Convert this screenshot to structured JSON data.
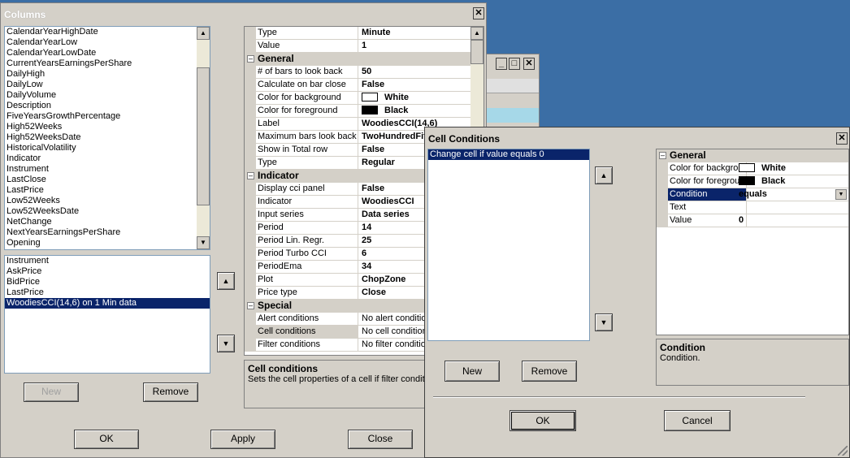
{
  "bg_window": {
    "col1": "",
    "col2": ""
  },
  "columns": {
    "title": "Columns",
    "available": [
      "CalendarYearHighDate",
      "CalendarYearLow",
      "CalendarYearLowDate",
      "CurrentYearsEarningsPerShare",
      "DailyHigh",
      "DailyLow",
      "DailyVolume",
      "Description",
      "FiveYearsGrowthPercentage",
      "High52Weeks",
      "High52WeeksDate",
      "HistoricalVolatility",
      "Indicator",
      "Instrument",
      "LastClose",
      "LastPrice",
      "Low52Weeks",
      "Low52WeeksDate",
      "NetChange",
      "NextYearsEarningsPerShare",
      "Opening"
    ],
    "selected": [
      "Instrument",
      "AskPrice",
      "BidPrice",
      "LastPrice",
      "WoodiesCCI(14,6) on 1 Min data"
    ],
    "new_label": "New",
    "remove_label": "Remove",
    "ok_label": "OK",
    "apply_label": "Apply",
    "close_label": "Close",
    "props": {
      "top": [
        [
          "Type",
          "Minute"
        ],
        [
          "Value",
          "1"
        ]
      ],
      "general_title": "General",
      "general": [
        [
          "# of bars to look back",
          "50"
        ],
        [
          "Calculate on bar close",
          "False"
        ],
        [
          "Color for background",
          "White"
        ],
        [
          "Color for foreground",
          "Black"
        ],
        [
          "Label",
          "WoodiesCCI(14,6)"
        ],
        [
          "Maximum bars look back",
          "TwoHundredFiftySix"
        ],
        [
          "Show in Total row",
          "False"
        ],
        [
          "Type",
          "Regular"
        ]
      ],
      "indicator_title": "Indicator",
      "indicator": [
        [
          "Display cci panel",
          "False"
        ],
        [
          "Indicator",
          "WoodiesCCI"
        ],
        [
          "Input series",
          "Data series"
        ],
        [
          "Period",
          "14"
        ],
        [
          "Period Lin. Regr.",
          "25"
        ],
        [
          "Period Turbo CCI",
          "6"
        ],
        [
          "PeriodEma",
          "34"
        ],
        [
          "Plot",
          "ChopZone"
        ],
        [
          "Price type",
          "Close"
        ]
      ],
      "special_title": "Special",
      "special": [
        [
          "Alert conditions",
          "No alert conditions"
        ],
        [
          "Cell conditions",
          "No cell conditions"
        ],
        [
          "Filter conditions",
          "No filter conditions"
        ]
      ]
    },
    "desc_title": "Cell conditions",
    "desc_text": "Sets the cell properties of a cell if filter condition met."
  },
  "cell_conditions": {
    "title": "Cell Conditions",
    "list": [
      "Change cell if value equals 0"
    ],
    "category": "General",
    "props": [
      [
        "Color for background",
        "White"
      ],
      [
        "Color for foreground",
        "Black"
      ],
      [
        "Condition",
        "equals"
      ],
      [
        "Text",
        ""
      ],
      [
        "Value",
        "0"
      ]
    ],
    "desc_title": "Condition",
    "desc_text": "Condition.",
    "new_label": "New",
    "remove_label": "Remove",
    "ok_label": "OK",
    "cancel_label": "Cancel"
  },
  "colors": {
    "selection": "#0a246a",
    "dialog": "#d4d0c8",
    "desktop": "#3b6ea5",
    "title_active": "#0a246a"
  },
  "icons": {
    "close": "close-icon",
    "minimize": "minimize-icon",
    "maximize": "maximize-icon",
    "up": "arrow-up-icon",
    "down": "arrow-down-icon",
    "collapse": "collapse-icon",
    "dropdown": "dropdown-arrow-icon"
  }
}
